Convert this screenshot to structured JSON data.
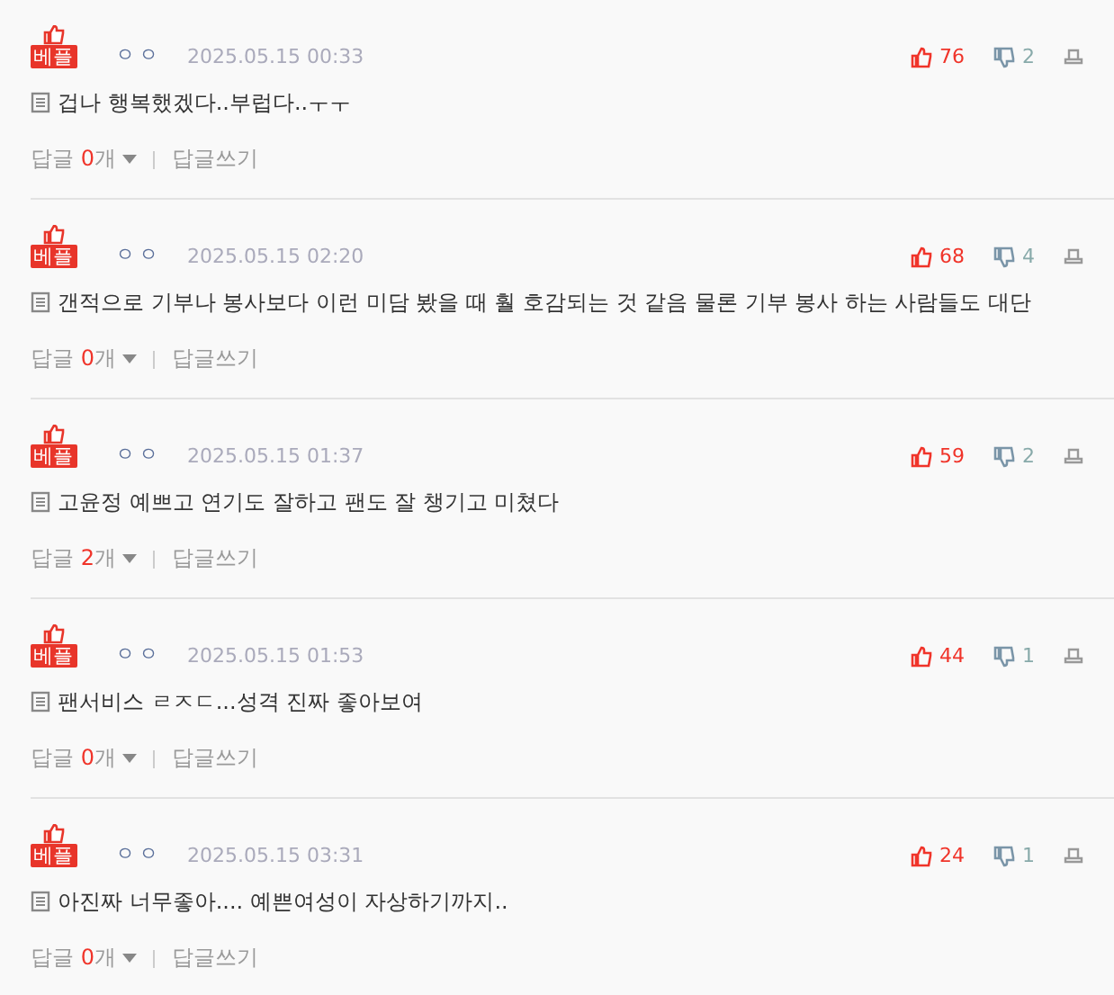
{
  "comments": [
    {
      "badge": "베플",
      "author": "ㅇㅇ",
      "date": "2025.05.15 00:33",
      "likes": "76",
      "dislikes": "2",
      "text": "겁나 행복했겠다..부럽다..ㅜㅜ",
      "reply_label": "답글",
      "reply_count": "0",
      "reply_unit": "개",
      "write_reply": "답글쓰기"
    },
    {
      "badge": "베플",
      "author": "ㅇㅇ",
      "date": "2025.05.15 02:20",
      "likes": "68",
      "dislikes": "4",
      "text": "갠적으로 기부나 봉사보다 이런 미담 봤을 때 훨 호감되는 것 같음 물론 기부 봉사 하는 사람들도 대단",
      "reply_label": "답글",
      "reply_count": "0",
      "reply_unit": "개",
      "write_reply": "답글쓰기"
    },
    {
      "badge": "베플",
      "author": "ㅇㅇ",
      "date": "2025.05.15 01:37",
      "likes": "59",
      "dislikes": "2",
      "text": "고윤정 예쁘고 연기도 잘하고 팬도 잘 챙기고 미쳤다",
      "reply_label": "답글",
      "reply_count": "2",
      "reply_unit": "개",
      "write_reply": "답글쓰기"
    },
    {
      "badge": "베플",
      "author": "ㅇㅇ",
      "date": "2025.05.15 01:53",
      "likes": "44",
      "dislikes": "1",
      "text": "팬서비스 ㄹㅈㄷ...성격 진짜 좋아보여",
      "reply_label": "답글",
      "reply_count": "0",
      "reply_unit": "개",
      "write_reply": "답글쓰기"
    },
    {
      "badge": "베플",
      "author": "ㅇㅇ",
      "date": "2025.05.15 03:31",
      "likes": "24",
      "dislikes": "1",
      "text": "아진짜 너무좋아.... 예쁜여성이 자상하기까지..",
      "reply_label": "답글",
      "reply_count": "0",
      "reply_unit": "개",
      "write_reply": "답글쓰기"
    }
  ]
}
